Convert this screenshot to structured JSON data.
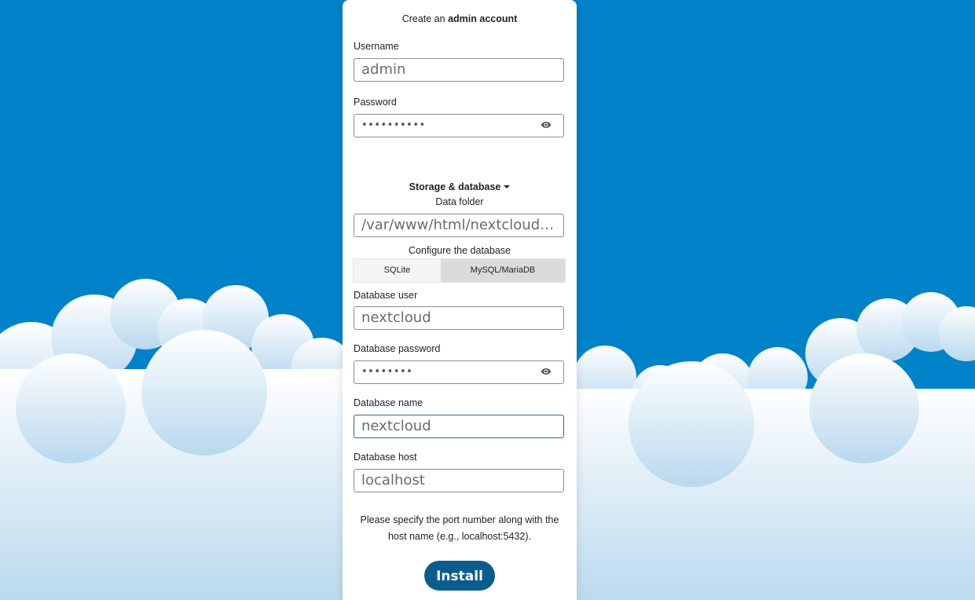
{
  "header": {
    "prefix": "Create an",
    "bold": "admin account"
  },
  "admin": {
    "username_label": "Username",
    "username_value": "admin",
    "password_label": "Password",
    "password_value": "••••••••••"
  },
  "storage": {
    "toggle_label": "Storage & database",
    "data_folder_label": "Data folder",
    "data_folder_value": "/var/www/html/nextcloud/d…",
    "configure_label": "Configure the database",
    "tabs": [
      {
        "label": "SQLite",
        "active": false
      },
      {
        "label": "MySQL/MariaDB",
        "active": true
      }
    ]
  },
  "database": {
    "user_label": "Database user",
    "user_value": "nextcloud",
    "password_label": "Database password",
    "password_value": "••••••••",
    "name_label": "Database name",
    "name_value": "nextcloud",
    "host_label": "Database host",
    "host_value": "localhost"
  },
  "hint": "Please specify the port number along with the host name (e.g., localhost:5432).",
  "install_label": "Install",
  "colors": {
    "sky": "#0082c9",
    "button": "#0b5c8e",
    "active_tab": "#dbdbdb"
  }
}
